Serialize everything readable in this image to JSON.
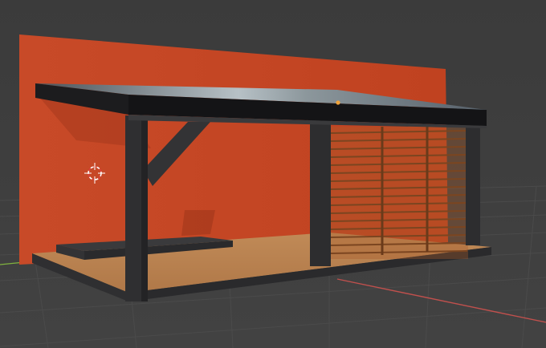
{
  "viewport": {
    "mode": "solid-shading",
    "grid_visible": true,
    "axis_x_color": "#c0504d",
    "axis_y_color": "#7fb23f"
  },
  "scene": {
    "objects": [
      "backdrop-wall",
      "floor-deck",
      "pergola-roof",
      "front-left-post",
      "front-right-post",
      "diagonal-brace",
      "slatted-screen",
      "bench-platform",
      "point-light"
    ],
    "colors": {
      "backdrop": "#c44625",
      "deck": "#bd8552",
      "frame": "#2e2e30",
      "roof_glass": "#6f7a80",
      "slats": "#7b4520"
    }
  },
  "gizmos": {
    "cursor_3d": "3d-cursor-icon",
    "light_origin": "light-origin-dot"
  }
}
